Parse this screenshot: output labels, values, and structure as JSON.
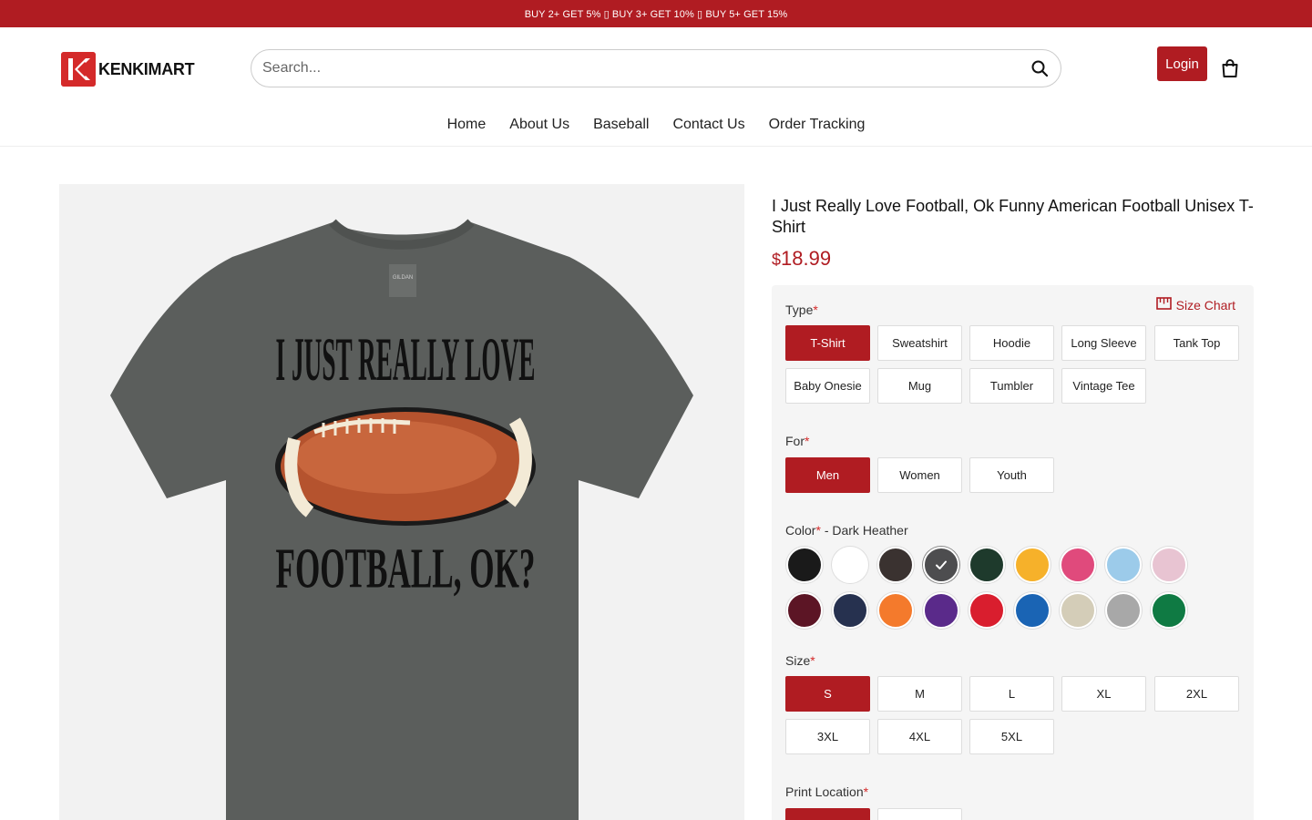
{
  "promo": {
    "text": "BUY 2+ GET 5% ▯ BUY 3+ GET 10% ▯ BUY 5+ GET 15%"
  },
  "brand": {
    "name": "KENKIMART",
    "accent": "#b01c22"
  },
  "search": {
    "placeholder": "Search..."
  },
  "header": {
    "login_label": "Login"
  },
  "nav": {
    "items": [
      "Home",
      "About Us",
      "Baseball",
      "Contact Us",
      "Order Tracking"
    ]
  },
  "product": {
    "title": "I Just Really Love Football, Ok Funny American Football Unisex T-Shirt",
    "currency": "$",
    "price": "18.99",
    "image": {
      "shirt_text_top": "I JUST REALLY LOVE",
      "shirt_text_bottom": "FOOTBALL, OK?",
      "tag": "GILDAN",
      "shirt_color": "#5b5e5c"
    }
  },
  "options": {
    "size_chart_label": "Size Chart",
    "type": {
      "label": "Type",
      "values": [
        "T-Shirt",
        "Sweatshirt",
        "Hoodie",
        "Long Sleeve",
        "Tank Top",
        "Baby Onesie",
        "Mug",
        "Tumbler",
        "Vintage Tee"
      ],
      "selected": "T-Shirt"
    },
    "for": {
      "label": "For",
      "values": [
        "Men",
        "Women",
        "Youth"
      ],
      "selected": "Men"
    },
    "color": {
      "label": "Color",
      "selected_name": "- Dark Heather",
      "swatches": [
        "#1a1a1a",
        "#ffffff",
        "#3a3230",
        "#4d4d4f",
        "#1e3a2c",
        "#f6b12a",
        "#e04a7c",
        "#9ccbea",
        "#e8c4d2",
        "#5c1525",
        "#26314f",
        "#f47a2c",
        "#5a2a8a",
        "#d91e2e",
        "#1a64b4",
        "#d4cdb8",
        "#a8a8a8",
        "#0f7a43"
      ],
      "selected_index": 3
    },
    "size": {
      "label": "Size",
      "values": [
        "S",
        "M",
        "L",
        "XL",
        "2XL",
        "3XL",
        "4XL",
        "5XL"
      ],
      "selected": "S"
    },
    "print_location": {
      "label": "Print Location"
    }
  }
}
